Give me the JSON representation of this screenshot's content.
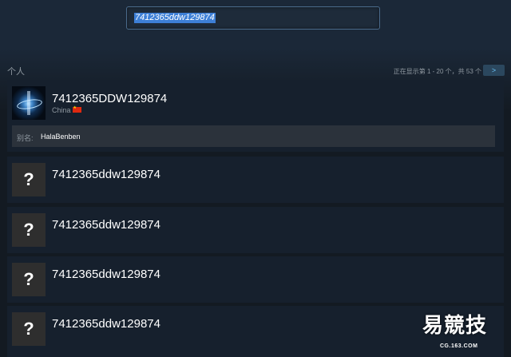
{
  "search": {
    "value": "7412365ddw129874"
  },
  "section": {
    "title": "个人",
    "paging": "正在显示第 1 - 20 个，共 53 个",
    "next_label": ">"
  },
  "results": [
    {
      "name": "7412365DDW129874",
      "location": "China",
      "flag_icon": "china-flag-icon",
      "alias_label": "别名:",
      "alias_value": "HalaBenben",
      "avatar_icon": "user-avatar-icon"
    },
    {
      "name": "7412365ddw129874",
      "avatar_text": "?",
      "avatar_icon": "unknown-avatar-icon"
    },
    {
      "name": "7412365ddw129874",
      "avatar_text": "?",
      "avatar_icon": "unknown-avatar-icon"
    },
    {
      "name": "7412365ddw129874",
      "avatar_text": "?",
      "avatar_icon": "unknown-avatar-icon"
    },
    {
      "name": "7412365ddw129874",
      "avatar_text": "?",
      "avatar_icon": "unknown-avatar-icon"
    }
  ],
  "watermark": {
    "logo": "易競技",
    "sub": "CG.163.COM"
  },
  "colors": {
    "background": "#1b2838",
    "card": "#16202d",
    "alias_bar": "#2b323b",
    "selection": "#3d7fd6",
    "accent": "#67c1f5",
    "muted_text": "#8f98a0"
  }
}
